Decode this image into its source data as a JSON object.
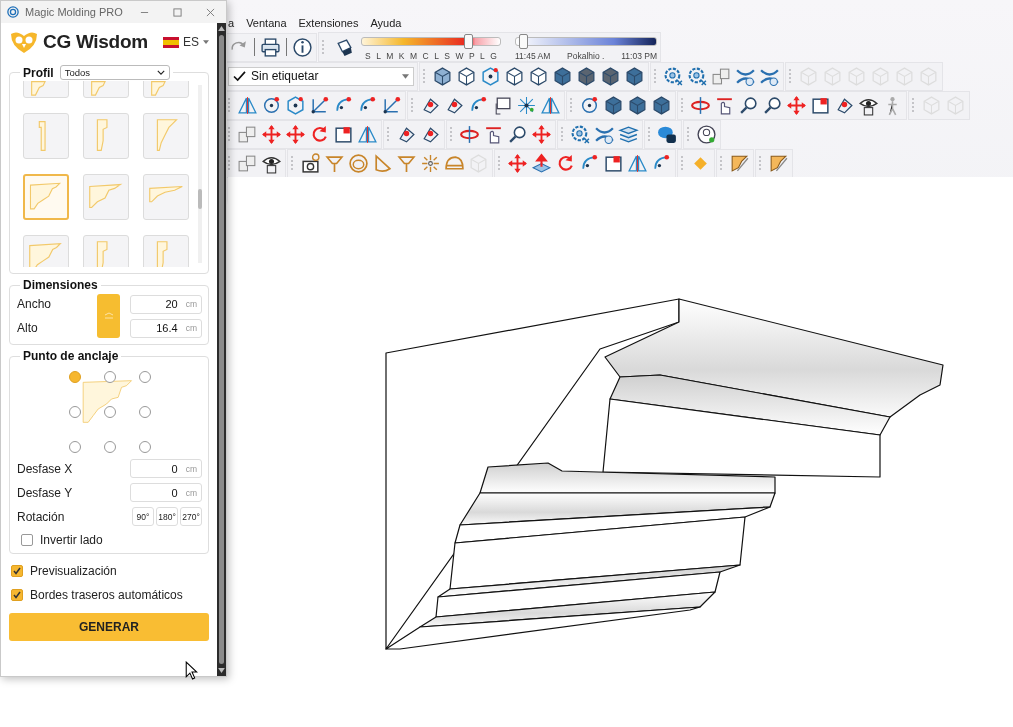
{
  "app": {
    "menu": [
      "a",
      "Ventana",
      "Extensiones",
      "Ayuda"
    ],
    "shadow_slider": {
      "letters": [
        "S",
        "L",
        "M",
        "K",
        "M",
        "C",
        "L",
        "S",
        "W",
        "P",
        "L",
        "G"
      ],
      "level": 0.79
    },
    "time_slider": {
      "start": "11:45 AM",
      "middle": "Pokalhio .",
      "end": "11:03 PM",
      "level": 0.02
    },
    "tag_dropdown": {
      "value": "Sin etiquetar"
    }
  },
  "plugin_window": {
    "title": "Magic Molding PRO",
    "brand": "CG Wisdom",
    "language": "ES",
    "profile": {
      "label": "Profil",
      "filter": "Todos",
      "items": [
        {
          "selected": false
        },
        {
          "selected": false
        },
        {
          "selected": false
        },
        {
          "selected": false
        },
        {
          "selected": false
        },
        {
          "selected": false
        },
        {
          "selected": true
        },
        {
          "selected": false
        },
        {
          "selected": false
        },
        {
          "selected": false
        },
        {
          "selected": false
        },
        {
          "selected": false
        }
      ]
    },
    "dimensions": {
      "title": "Dimensiones",
      "fields": [
        {
          "label": "Ancho",
          "value": "20",
          "unit": "cm"
        },
        {
          "label": "Alto",
          "value": "16.4",
          "unit": "cm"
        }
      ]
    },
    "anchor": {
      "title": "Punto de anclaje",
      "points": [
        {
          "selected": true
        },
        {
          "selected": false
        },
        {
          "selected": false
        },
        {
          "selected": false
        },
        {
          "selected": false
        },
        {
          "selected": false
        },
        {
          "selected": false
        },
        {
          "selected": false
        },
        {
          "selected": false
        }
      ],
      "offsets": [
        {
          "label": "Desfase X",
          "value": "0",
          "unit": "cm"
        },
        {
          "label": "Desfase Y",
          "value": "0",
          "unit": "cm"
        }
      ],
      "rotation": {
        "label": "Rotación",
        "options": [
          "90°",
          "180°",
          "270°"
        ]
      },
      "flip": {
        "label": "Invertir lado",
        "checked": false
      }
    },
    "options": [
      {
        "label": "Previsualización",
        "checked": true
      },
      {
        "label": "Bordes traseros automáticos",
        "checked": true
      }
    ],
    "generate_button": "GENERAR"
  }
}
